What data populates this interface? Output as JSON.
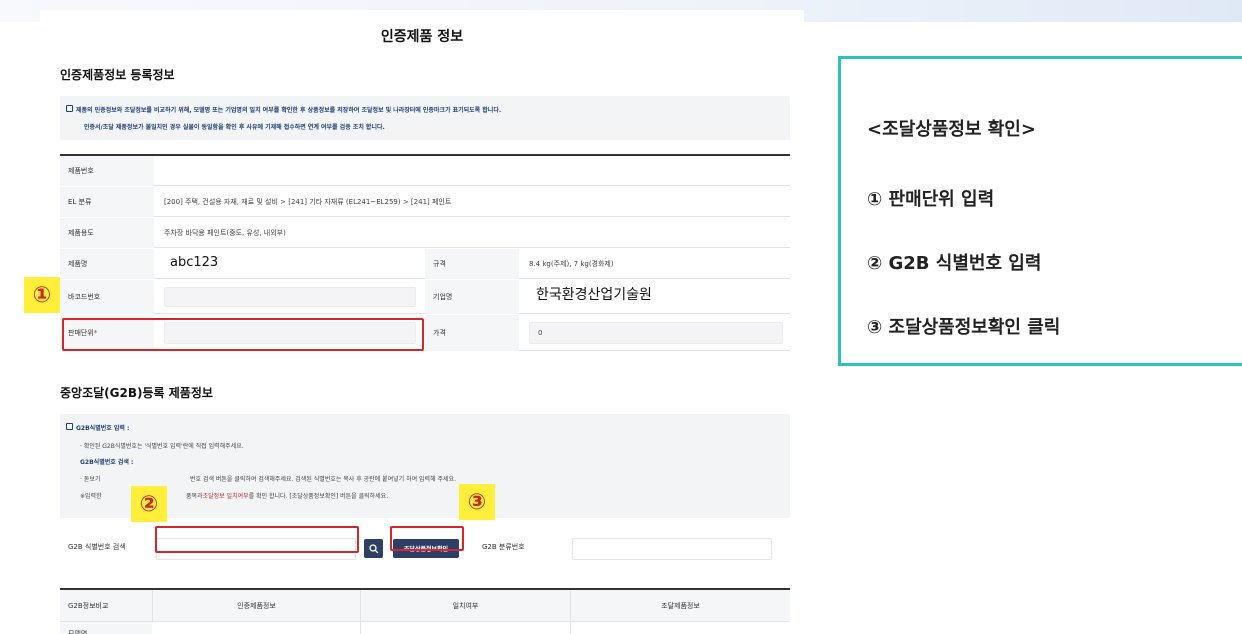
{
  "page": {
    "title": "인증제품 정보"
  },
  "cert_section": {
    "title": "인증제품정보 등록정보",
    "notice_line1": "제품의 인증정보와 조달정보를 비교하기 위해, 모델명 또는 기업명의 일치 여부를 확인한 후 상품정보를 저장하여 조달정보 및 나라장터에 인증마크가 표기되도록 합니다.",
    "notice_line2": "인증서/조달 제품정보가 불일치인 경우 실물이 동일함을 확인 후 사유에 기재해 접수하면 연계 여부를 검증 조치 합니다."
  },
  "form": {
    "product_no_label": "제품번호",
    "el_label": "EL 분류",
    "el_value": "[200] 주택, 건설용 자재, 재료 및 설비 > [241] 기타 자재류 (EL241~EL259) > [241] 페인트",
    "usage_label": "제품용도",
    "usage_value": "주차장 바닥용 페인트(중도, 유성, 내외부)",
    "name_label": "제품명",
    "name_value": "abc123",
    "spec_label": "규격",
    "spec_value": "8.4 kg(주제), 7 kg(경화제)",
    "barcode_label": "바코드번호",
    "company_label": "기업명",
    "company_value": "한국환경산업기술원",
    "unit_label": "판매단위",
    "unit_required": "*",
    "price_label": "가격",
    "price_value": "0"
  },
  "g2b_section": {
    "title": "중앙조달(G2B)등록 제품정보",
    "input_heading": "G2B식별번호 입력 :",
    "input_desc": "· 확인된 G2B식별번호는 '식별번호 입력'란에 직접 입력해주세요.",
    "search_heading": "G2B식별번호 검색 :",
    "search_desc_a": "· 돋보기",
    "search_desc_b": "번호 검색 버튼을 클릭하여 검색해주세요. 검색된 식별번호는 복사 후 공란에 붙여넣기 하여 입력해 주세요.",
    "note_a": "※입력한",
    "note_b": "품목과",
    "note_red": "조달정보 일치여부",
    "note_c": "를 확인 합니다. [조달상품정보확인] 버튼을 클릭하세요.",
    "search_label": "G2B 식별번호 검색",
    "confirm_button": "조달상품정보확인",
    "class_label": "G2B 분류번호"
  },
  "compare_table": {
    "headers": [
      "G2B정보비교",
      "인증제품정보",
      "일치여부",
      "조달제품정보"
    ],
    "row1_label": "모델명"
  },
  "badges": {
    "one": "①",
    "two": "②",
    "three": "③"
  },
  "side_panel": {
    "title": "<조달상품정보 확인>",
    "step1": "① 판매단위 입력",
    "step2": "② G2B 식별번호 입력",
    "step3": "③ 조달상품정보확인 클릭"
  },
  "colors": {
    "accent_navy": "#2d3f66",
    "highlight_red": "#d6262c",
    "badge_yellow": "#ffef3a",
    "panel_teal": "#2fc1c0"
  }
}
